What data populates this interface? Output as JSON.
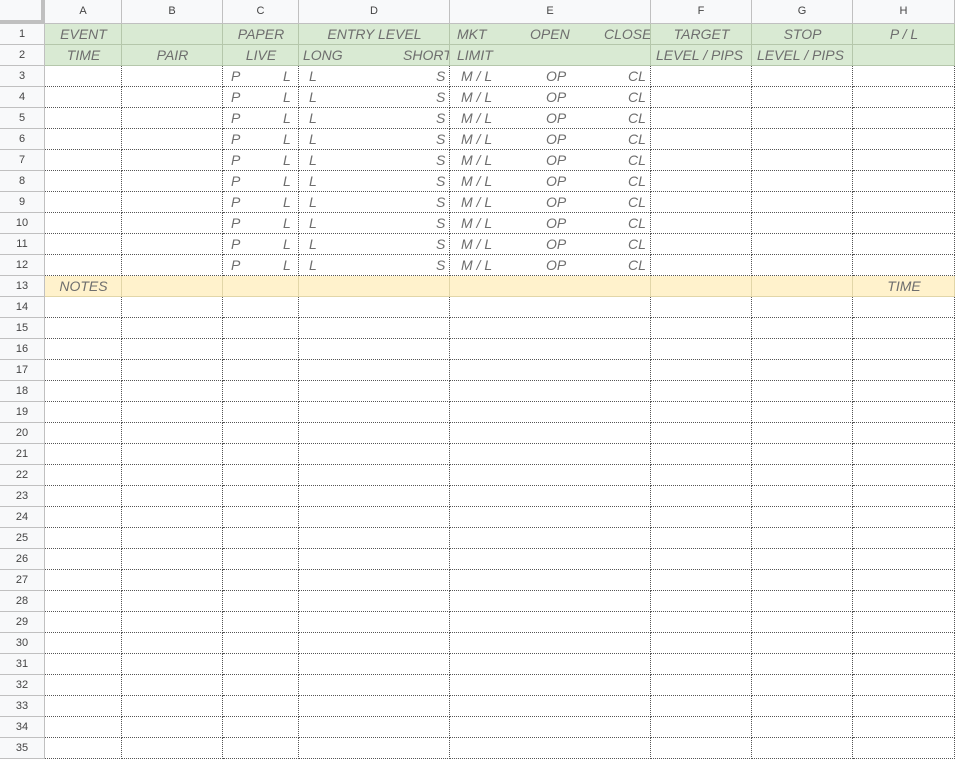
{
  "columns": [
    "A",
    "B",
    "C",
    "D",
    "E",
    "F",
    "G",
    "H"
  ],
  "row_numbers": [
    "1",
    "2",
    "3",
    "4",
    "5",
    "6",
    "7",
    "8",
    "9",
    "10",
    "11",
    "12",
    "13",
    "14",
    "15",
    "16",
    "17",
    "18",
    "19",
    "20",
    "21",
    "22",
    "23",
    "24",
    "25",
    "26",
    "27",
    "28",
    "29",
    "30",
    "31",
    "32",
    "33",
    "34",
    "35"
  ],
  "header": {
    "row1": {
      "event": "EVENT",
      "paper": "PAPER",
      "entry_level": "ENTRY LEVEL",
      "mkt": "MKT",
      "open": "OPEN",
      "close": "CLOSE",
      "target": "TARGET",
      "stop": "STOP",
      "pl": "P / L"
    },
    "row2": {
      "time": "TIME",
      "pair": "PAIR",
      "live": "LIVE",
      "long": "LONG",
      "short": "SHORT",
      "limit": "LIMIT",
      "target_sub": "LEVEL  /  PIPS",
      "stop_sub": "LEVEL  /  PIPS"
    }
  },
  "entry_row": {
    "paper": "P",
    "live": "L",
    "long": "L",
    "short": "S",
    "mkt_limit": "M / L",
    "open": "OP",
    "close": "CL"
  },
  "entry_row_count": 10,
  "notes_row": {
    "notes": "NOTES",
    "time": "TIME"
  },
  "colors": {
    "header_green": "#d9ead3",
    "notes_yellow": "#fff2cc"
  }
}
